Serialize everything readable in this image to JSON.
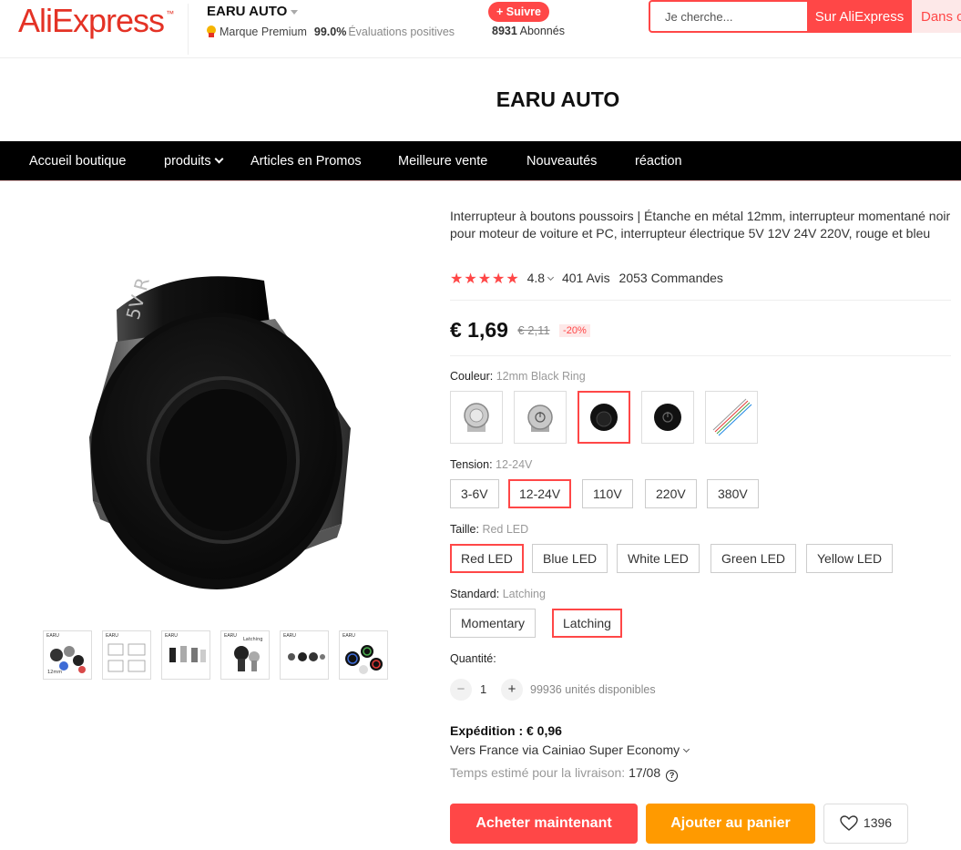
{
  "header": {
    "logo": "AliExpress",
    "logo_tm": "™",
    "store_name": "EARU AUTO",
    "premium_label": "Marque Premium",
    "rating": "99.0%",
    "rating_label": "Évaluations positives",
    "follow_label": "+ Suivre",
    "followers_count": "8931",
    "followers_label": "Abonnés",
    "search_placeholder": "Je cherche...",
    "search_button": "Sur AliExpress",
    "search_button2": "Dans cette boutique"
  },
  "banner": {
    "title": "EARU AUTO"
  },
  "nav": {
    "items": [
      "Accueil boutique",
      "produits",
      "Articles en Promos",
      "Meilleure vente",
      "Nouveautés",
      "réaction"
    ]
  },
  "product": {
    "title": "Interrupteur à boutons poussoirs | Étanche en métal 12mm, interrupteur momentané noir pour moteur de voiture et PC, interrupteur électrique 5V 12V 24V 220V, rouge et bleu",
    "stars": "★★★★★",
    "score": "4.8",
    "reviews": "401 Avis",
    "orders": "2053 Commandes",
    "price": "€ 1,69",
    "old_price": "€ 2,11",
    "discount": "-20%",
    "image_engraving": "5V R",
    "thumb_labels": [
      "EARU",
      "EARU",
      "EARU",
      "EARU",
      "EARU",
      "EARU"
    ],
    "thumb_extra": [
      "12mm",
      "Latching"
    ]
  },
  "options": {
    "color": {
      "label": "Couleur:",
      "value": "12mm Black Ring",
      "selected_index": 2
    },
    "tension": {
      "label": "Tension:",
      "value": "12-24V",
      "items": [
        "3-6V",
        "12-24V",
        "110V",
        "220V",
        "380V"
      ],
      "selected_index": 1
    },
    "taille": {
      "label": "Taille:",
      "value": "Red LED",
      "items": [
        "Red LED",
        "Blue LED",
        "White LED",
        "Green LED",
        "Yellow LED"
      ],
      "selected_index": 0
    },
    "standard": {
      "label": "Standard:",
      "value": "Latching",
      "items": [
        "Momentary",
        "Latching"
      ],
      "selected_index": 1
    }
  },
  "quantity": {
    "label": "Quantité:",
    "minus": "−",
    "plus": "+",
    "value": "1",
    "available": "99936 unités disponibles"
  },
  "shipping": {
    "title": "Expédition : € 0,96",
    "route": "Vers France via Cainiao Super Economy",
    "time_label": "Temps estimé pour la livraison:",
    "time_value": "17/08",
    "help": "?"
  },
  "actions": {
    "buy": "Acheter maintenant",
    "cart": "Ajouter au panier",
    "wish_count": "1396"
  },
  "colors": {
    "brand_red": "#ff4747",
    "cart_orange": "#ff9a00",
    "nav_bg": "#000000"
  }
}
